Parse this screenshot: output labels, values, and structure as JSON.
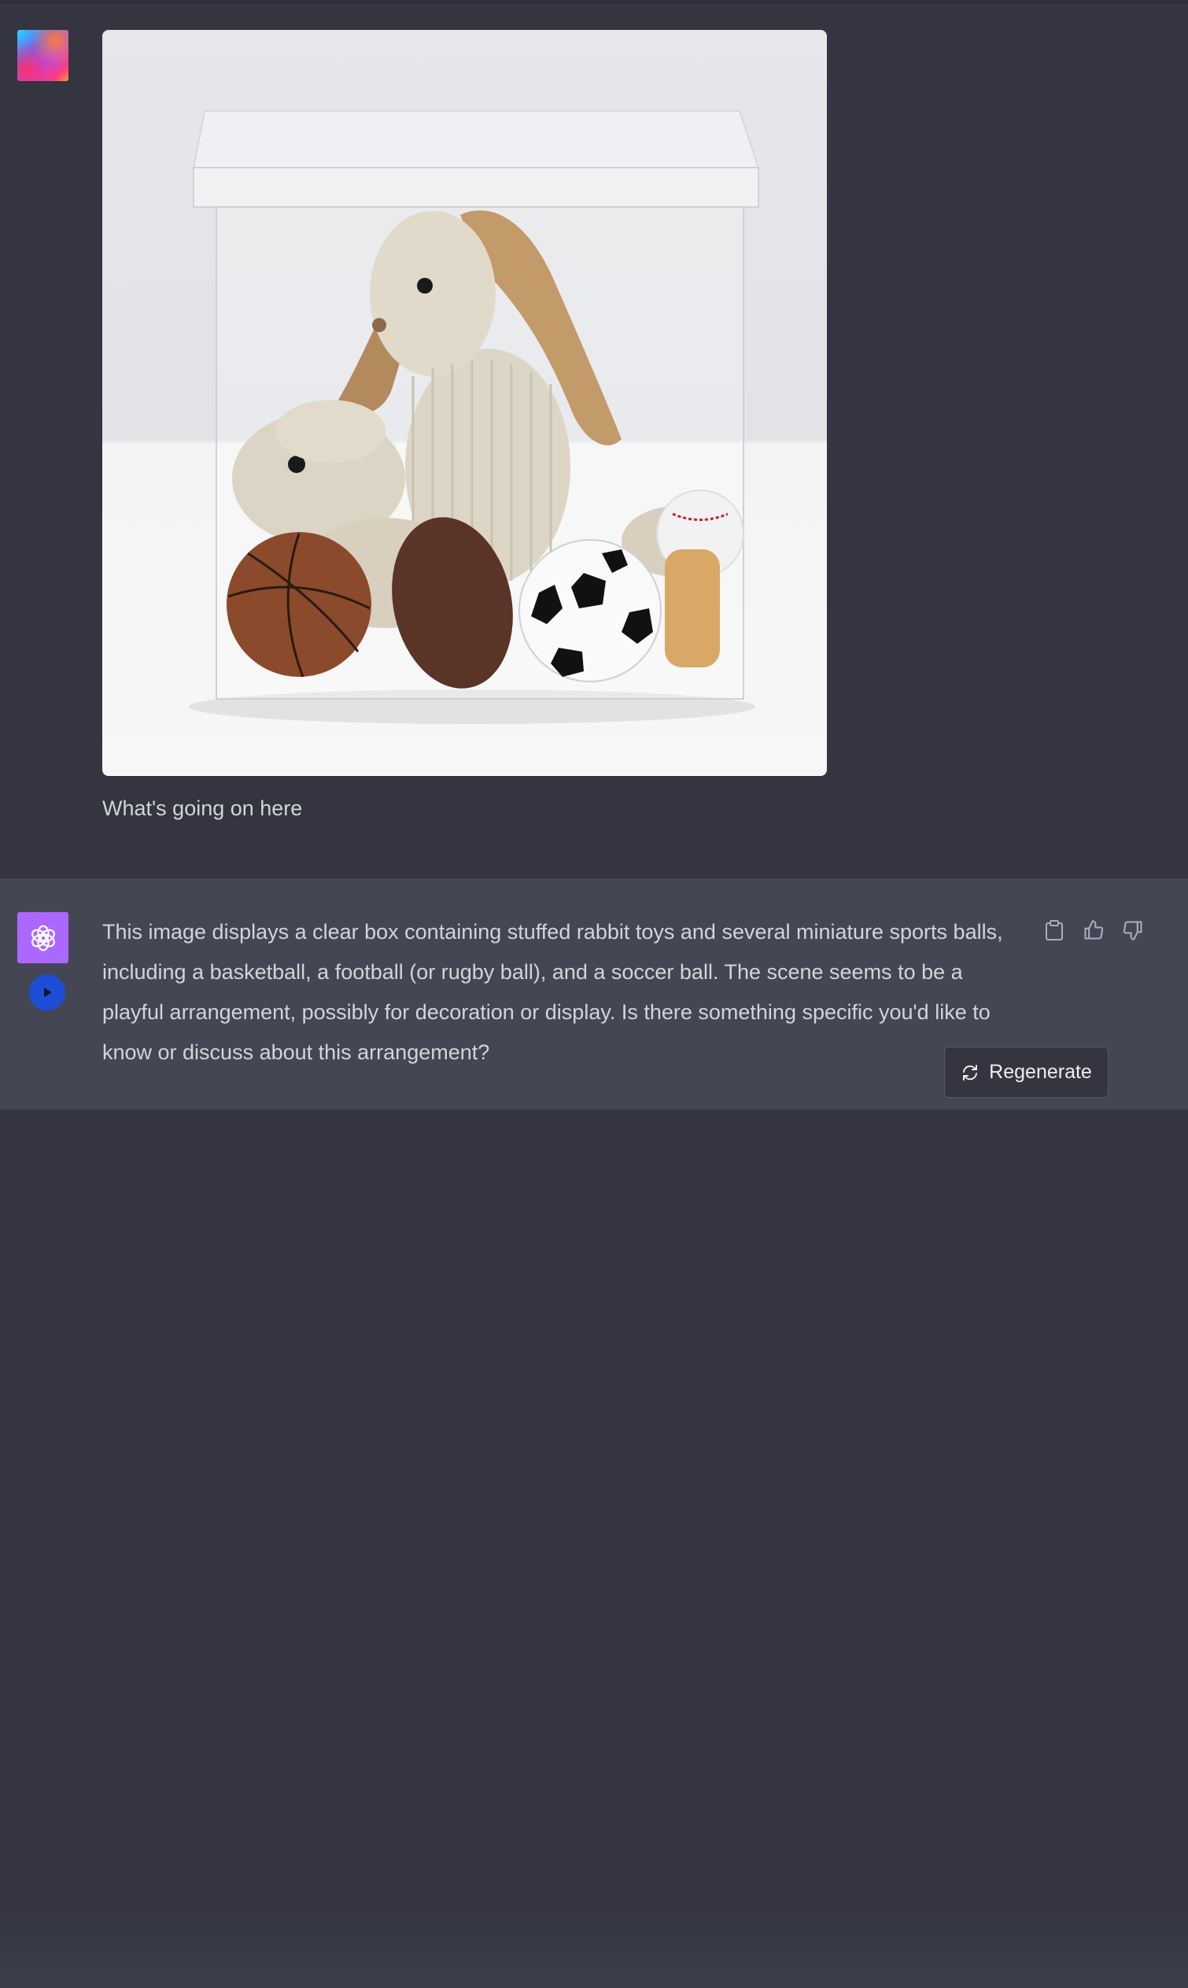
{
  "conversation": {
    "user": {
      "avatar_icon": "user-avatar-gradient",
      "image_alt": "clear box containing stuffed rabbit toys and miniature sports balls",
      "message": "What's going on here"
    },
    "assistant": {
      "avatar_icon": "openai-logo-icon",
      "message": "This image displays a clear box containing stuffed rabbit toys and several miniature sports balls, including a basketball, a football (or rugby ball), and a soccer ball. The scene seems to be a playful arrangement, possibly for decoration or display. Is there something specific you'd like to know or discuss about this arrangement?",
      "actions": [
        "copy-icon",
        "thumbs-up-icon",
        "thumbs-down-icon"
      ]
    }
  },
  "controls": {
    "regenerate_label": "Regenerate",
    "regenerate_icon": "refresh-icon",
    "read_aloud_icon": "play-icon"
  },
  "colors": {
    "background": "#343541",
    "assistant_background": "#444654",
    "gpt_avatar": "#ab68ff",
    "play_button": "#1d4ed8",
    "text": "#d1d5db"
  }
}
